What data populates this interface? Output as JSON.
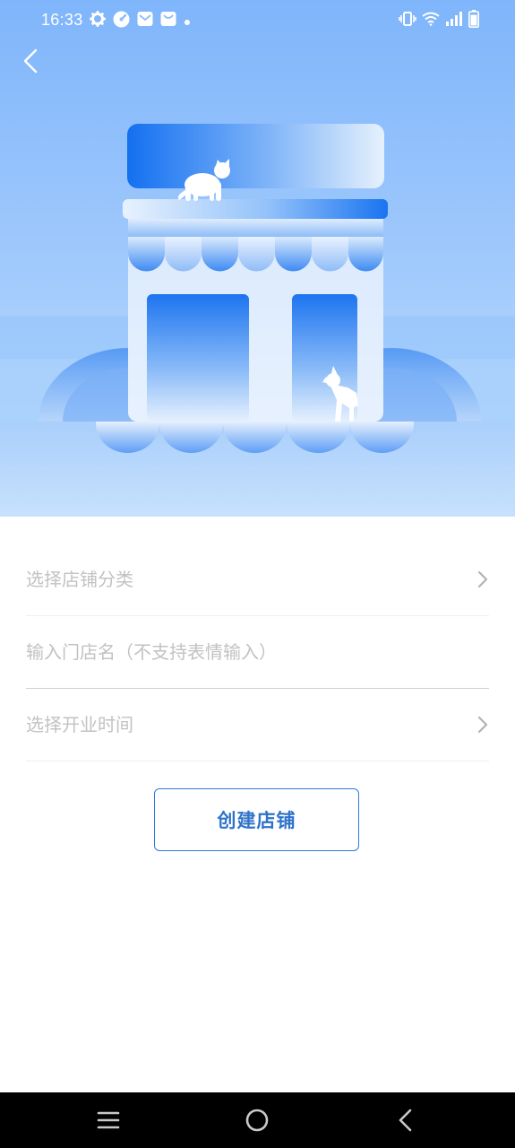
{
  "status_bar": {
    "time": "16:33",
    "left_icons": [
      "settings-icon",
      "speedometer-icon",
      "mail-icon",
      "shopping-bag-icon",
      "dot-icon"
    ],
    "right_icons": [
      "vibrate-icon",
      "wifi-icon",
      "cellular-signal-icon",
      "battery-icon"
    ]
  },
  "header": {
    "back_icon": "chevron-left-icon"
  },
  "hero": {
    "illustration": "storefront-illustration",
    "decorations": [
      "cat-silhouette",
      "dog-silhouette"
    ]
  },
  "form": {
    "category": {
      "label": "选择店铺分类",
      "icon": "chevron-right-icon"
    },
    "store_name": {
      "value": "",
      "placeholder": "输入门店名（不支持表情输入）"
    },
    "open_time": {
      "label": "选择开业时间",
      "icon": "chevron-right-icon"
    }
  },
  "actions": {
    "create_label": "创建店铺"
  },
  "nav_bar": {
    "buttons": [
      "menu-icon",
      "home-circle-icon",
      "back-triangle-icon"
    ]
  },
  "colors": {
    "accent": "#2f73c9",
    "hero_top": "#7fb5fb",
    "hero_bottom": "#c9e3fd",
    "placeholder_text": "#c2c2c2",
    "divider": "#cfcfcf"
  }
}
